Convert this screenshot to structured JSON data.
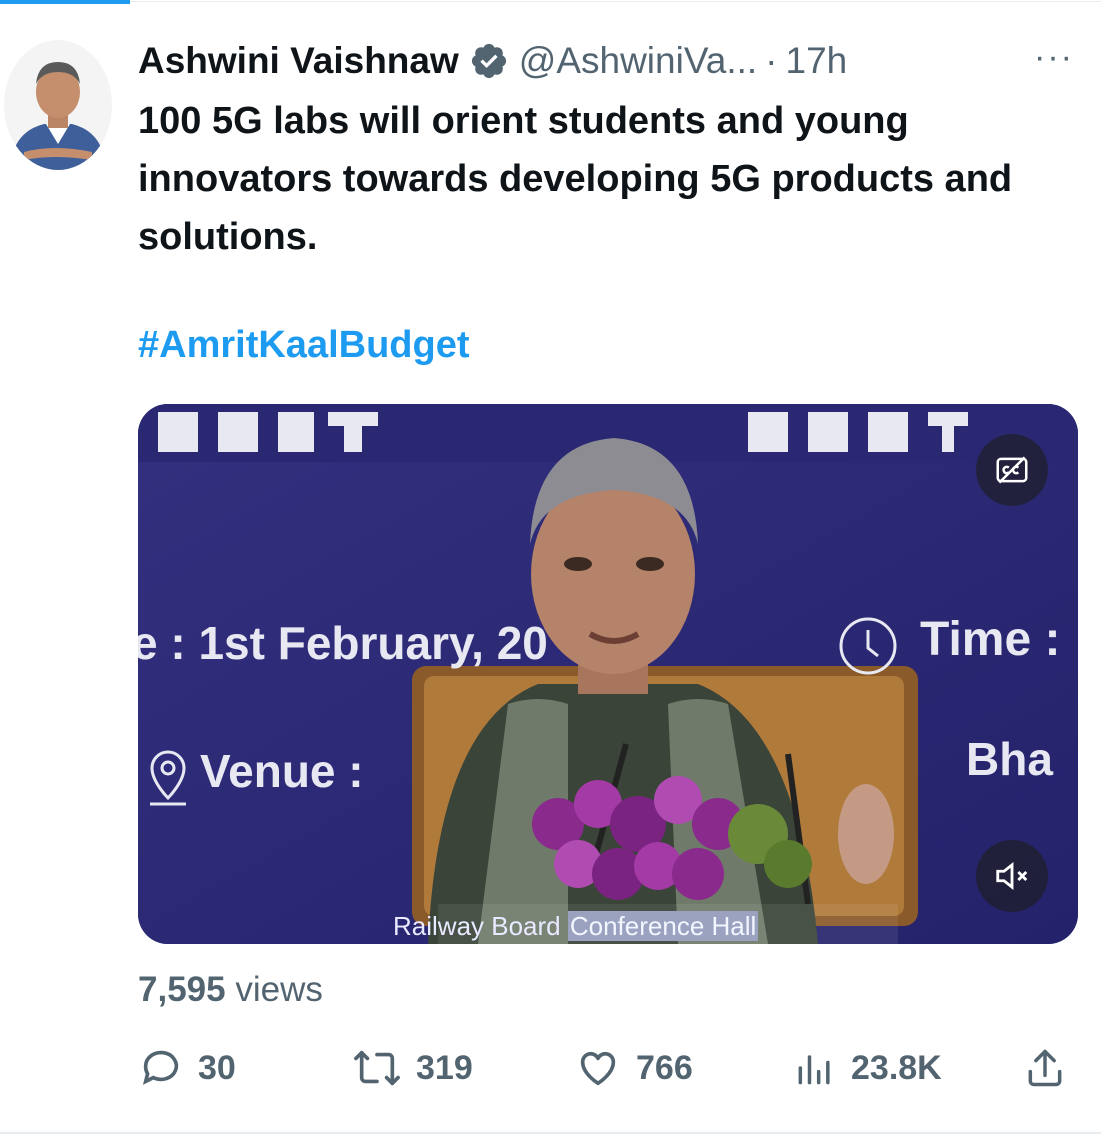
{
  "author": {
    "name": "Ashwini Vaishnaw",
    "handle": "@AshwiniVa...",
    "separator": "·",
    "time": "17h",
    "more_label": "···"
  },
  "tweet": {
    "text": "100 5G labs will orient students and young innovators towards developing 5G products and solutions.",
    "hashtag": "#AmritKaalBudget"
  },
  "media": {
    "backdrop_lines": [
      "e : 1st February, 20",
      "Time :",
      "Venue :",
      "Bha"
    ],
    "caption_part1": "Railway Board ",
    "caption_part2": "Conference Hall"
  },
  "stats": {
    "views_count": "7,595",
    "views_label": "views"
  },
  "actions": {
    "replies": "30",
    "retweets": "319",
    "likes": "766",
    "views": "23.8K"
  },
  "colors": {
    "accent": "#1d9bf0",
    "text": "#0f1419",
    "muted": "#536471",
    "video_bg": "#2d2b7a"
  },
  "icons": [
    "verified-badge-icon",
    "more-icon",
    "closed-captions-icon",
    "mute-icon",
    "reply-icon",
    "retweet-icon",
    "like-icon",
    "views-icon",
    "share-icon"
  ]
}
